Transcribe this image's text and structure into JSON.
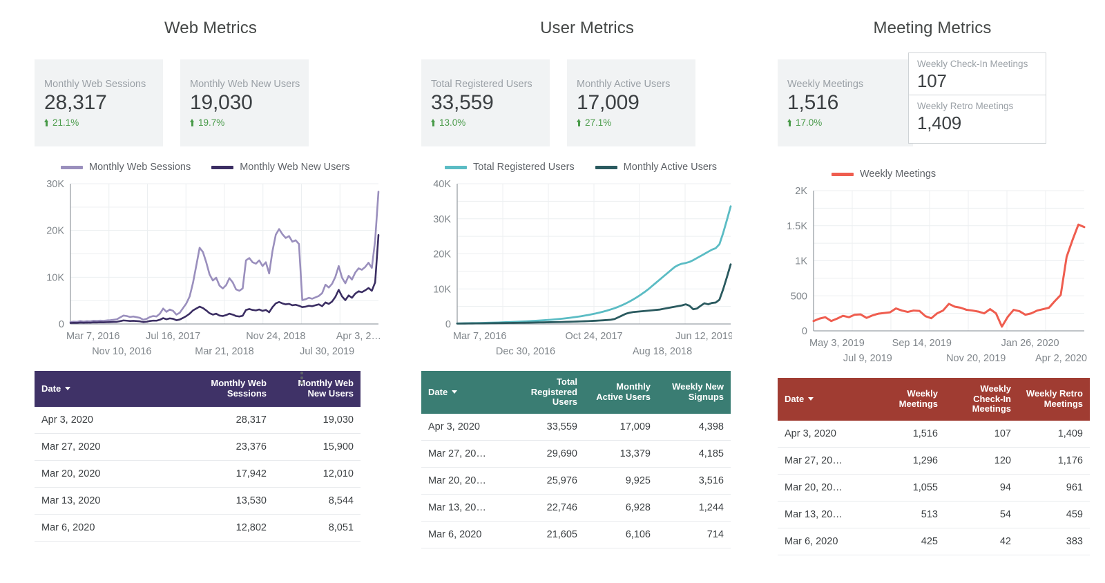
{
  "panels": [
    {
      "title": "Web Metrics",
      "scorecards": [
        {
          "label": "Monthly Web Sessions",
          "value": "28,317",
          "delta": "21.1%"
        },
        {
          "label": "Monthly Web New Users",
          "value": "19,030",
          "delta": "19.7%"
        }
      ],
      "legend": [
        {
          "label": "Monthly Web Sessions",
          "color": "#9a8fbd"
        },
        {
          "label": "Monthly Web New Users",
          "color": "#3b2e63"
        }
      ],
      "table": {
        "header_color": "#3f3267",
        "columns": [
          "Date",
          "Monthly Web Sessions",
          "Monthly Web New Users"
        ],
        "rows": [
          [
            "Apr 3, 2020",
            "28,317",
            "19,030"
          ],
          [
            "Mar 27, 2020",
            "23,376",
            "15,900"
          ],
          [
            "Mar 20, 2020",
            "17,942",
            "12,010"
          ],
          [
            "Mar 13, 2020",
            "13,530",
            "8,544"
          ],
          [
            "Mar 6, 2020",
            "12,802",
            "8,051"
          ]
        ]
      }
    },
    {
      "title": "User Metrics",
      "scorecards": [
        {
          "label": "Total Registered Users",
          "value": "33,559",
          "delta": "13.0%"
        },
        {
          "label": "Monthly Active Users",
          "value": "17,009",
          "delta": "27.1%"
        }
      ],
      "legend": [
        {
          "label": "Total Registered Users",
          "color": "#5bbcc4"
        },
        {
          "label": "Monthly Active Users",
          "color": "#2a5a5f"
        }
      ],
      "table": {
        "header_color": "#3a7d73",
        "columns": [
          "Date",
          "Total Registered Users",
          "Monthly Active Users",
          "Weekly New Signups"
        ],
        "rows": [
          [
            "Apr 3, 2020",
            "33,559",
            "17,009",
            "4,398"
          ],
          [
            "Mar 27, 20…",
            "29,690",
            "13,379",
            "4,185"
          ],
          [
            "Mar 20, 20…",
            "25,976",
            "9,925",
            "3,516"
          ],
          [
            "Mar 13, 20…",
            "22,746",
            "6,928",
            "1,244"
          ],
          [
            "Mar 6, 2020",
            "21,605",
            "6,106",
            "714"
          ]
        ]
      }
    },
    {
      "title": "Meeting Metrics",
      "scorecards": [
        {
          "label": "Weekly Meetings",
          "value": "1,516",
          "delta": "17.0%"
        }
      ],
      "boxed_scorecards": [
        {
          "label": "Weekly Check-In Meetings",
          "value": "107"
        },
        {
          "label": "Weekly Retro Meetings",
          "value": "1,409"
        }
      ],
      "legend": [
        {
          "label": "Weekly Meetings",
          "color": "#ef5d4f"
        }
      ],
      "table": {
        "header_color": "#a03c32",
        "columns": [
          "Date",
          "Weekly Meetings",
          "Weekly Check-In Meetings",
          "Weekly Retro Meetings"
        ],
        "rows": [
          [
            "Apr 3, 2020",
            "1,516",
            "107",
            "1,409"
          ],
          [
            "Mar 27, 20…",
            "1,296",
            "120",
            "1,176"
          ],
          [
            "Mar 20, 20…",
            "1,055",
            "94",
            "961"
          ],
          [
            "Mar 13, 20…",
            "513",
            "54",
            "459"
          ],
          [
            "Mar 6, 2020",
            "425",
            "42",
            "383"
          ]
        ]
      }
    }
  ],
  "chart_data": [
    {
      "type": "line",
      "title": "Web Metrics",
      "xlabel": "",
      "ylabel": "",
      "ylim": [
        0,
        30000
      ],
      "yticks": [
        0,
        10000,
        20000,
        30000
      ],
      "ytick_labels": [
        "0",
        "10K",
        "20K",
        "30K"
      ],
      "grid": true,
      "legend_position": "top",
      "xtick_labels_row1": [
        "Mar 7, 2016",
        "Jul 16, 2017",
        "Nov 24, 2018",
        "Apr 3, 2…"
      ],
      "xtick_labels_row2": [
        "Nov 10, 2016",
        "Mar 21, 2018",
        "Jul 30, 2019"
      ],
      "series": [
        {
          "name": "Monthly Web Sessions",
          "color": "#9a8fbd",
          "values": [
            420,
            500,
            460,
            620,
            520,
            600,
            560,
            700,
            650,
            720,
            680,
            760,
            800,
            900,
            1000,
            1400,
            1800,
            1700,
            1500,
            1600,
            1450,
            1300,
            900,
            1100,
            1500,
            1700,
            1600,
            2200,
            3300,
            2600,
            3100,
            2800,
            2000,
            2400,
            3400,
            4400,
            5900,
            8800,
            12500,
            16300,
            15400,
            13200,
            10600,
            9300,
            9900,
            8200,
            7600,
            8300,
            9800,
            8900,
            7400,
            7100,
            7600,
            13600,
            14100,
            13200,
            12900,
            13600,
            12400,
            13200,
            10800,
            15600,
            19100,
            20300,
            19200,
            18400,
            18800,
            17600,
            17900,
            17100,
            5100,
            5300,
            5600,
            5400,
            5700,
            6000,
            6600,
            8400,
            7800,
            8600,
            10100,
            12400,
            9900,
            8700,
            10300,
            9500,
            11000,
            11900,
            11600,
            12200,
            13100,
            12000,
            17900,
            28317
          ]
        },
        {
          "name": "Monthly Web New Users",
          "color": "#3b2e63",
          "values": [
            210,
            250,
            230,
            300,
            270,
            300,
            280,
            340,
            320,
            360,
            340,
            380,
            400,
            430,
            460,
            600,
            760,
            700,
            640,
            680,
            620,
            560,
            400,
            480,
            640,
            720,
            700,
            900,
            1250,
            1000,
            1200,
            1100,
            800,
            950,
            1300,
            1700,
            2200,
            2900,
            3300,
            3700,
            3400,
            2900,
            2300,
            2000,
            2200,
            1800,
            1700,
            1900,
            2200,
            2000,
            1700,
            1600,
            1750,
            3000,
            3200,
            3000,
            2900,
            3100,
            2800,
            3000,
            2500,
            3600,
            4400,
            4700,
            4400,
            4200,
            4300,
            4000,
            4100,
            3900,
            3600,
            3700,
            3900,
            3800,
            4000,
            4200,
            3800,
            4600,
            4300,
            4800,
            5800,
            7300,
            5900,
            5100,
            6100,
            5600,
            6500,
            7000,
            6800,
            7200,
            7700,
            7100,
            8900,
            19030
          ]
        }
      ]
    },
    {
      "type": "line",
      "title": "User Metrics",
      "xlabel": "",
      "ylabel": "",
      "ylim": [
        0,
        40000
      ],
      "yticks": [
        0,
        10000,
        20000,
        30000,
        40000
      ],
      "ytick_labels": [
        "0",
        "10K",
        "20K",
        "30K",
        "40K"
      ],
      "grid": true,
      "legend_position": "top",
      "xtick_labels_row1": [
        "Mar 7, 2016",
        "Oct 24, 2017",
        "Jun 12, 2019"
      ],
      "xtick_labels_row2": [
        "Dec 30, 2016",
        "Aug 18, 2018"
      ],
      "series": [
        {
          "name": "Total Registered Users",
          "color": "#5bbcc4",
          "values": [
            150,
            170,
            190,
            210,
            230,
            250,
            270,
            300,
            330,
            360,
            390,
            420,
            460,
            500,
            540,
            580,
            630,
            680,
            730,
            790,
            850,
            910,
            980,
            1050,
            1130,
            1210,
            1300,
            1400,
            1500,
            1620,
            1750,
            1890,
            2040,
            2200,
            2380,
            2570,
            2780,
            3000,
            3250,
            3520,
            3820,
            4150,
            4500,
            4900,
            5350,
            5850,
            6400,
            7000,
            7650,
            8350,
            9100,
            9900,
            10800,
            11700,
            12600,
            13500,
            14400,
            15300,
            16200,
            16800,
            17200,
            17400,
            17700,
            18200,
            18800,
            19400,
            20000,
            20600,
            21200,
            21605,
            22746,
            25976,
            29690,
            33559
          ]
        },
        {
          "name": "Monthly Active Users",
          "color": "#2a5a5f",
          "values": [
            120,
            130,
            140,
            150,
            160,
            170,
            180,
            190,
            200,
            215,
            230,
            245,
            260,
            275,
            290,
            305,
            320,
            340,
            360,
            380,
            400,
            420,
            440,
            460,
            480,
            500,
            520,
            545,
            570,
            600,
            630,
            660,
            700,
            740,
            780,
            820,
            870,
            920,
            980,
            1050,
            1120,
            1200,
            1400,
            1900,
            2400,
            2900,
            3200,
            3400,
            3500,
            3600,
            3700,
            3800,
            3900,
            4000,
            4100,
            4300,
            4500,
            4700,
            4900,
            5100,
            5300,
            5600,
            5200,
            4200,
            4400,
            5200,
            5900,
            5600,
            6000,
            6106,
            6928,
            9925,
            13379,
            17009
          ]
        }
      ]
    },
    {
      "type": "line",
      "title": "Meeting Metrics",
      "xlabel": "",
      "ylabel": "",
      "ylim": [
        0,
        2000
      ],
      "yticks": [
        0,
        500,
        1000,
        1500,
        2000
      ],
      "ytick_labels": [
        "0",
        "500",
        "1K",
        "1.5K",
        "2K"
      ],
      "grid": true,
      "legend_position": "top",
      "xtick_labels_row1": [
        "May 3, 2019",
        "Sep 14, 2019",
        "Jan 26, 2020"
      ],
      "xtick_labels_row2": [
        "Jul 9, 2019",
        "Nov 20, 2019",
        "Apr 2, 2020"
      ],
      "series": [
        {
          "name": "Weekly Meetings",
          "color": "#ef5d4f",
          "values": [
            140,
            175,
            195,
            140,
            175,
            215,
            195,
            230,
            235,
            185,
            220,
            245,
            255,
            265,
            320,
            290,
            270,
            290,
            285,
            210,
            180,
            250,
            290,
            385,
            345,
            330,
            300,
            290,
            275,
            250,
            310,
            250,
            60,
            200,
            300,
            280,
            230,
            250,
            290,
            310,
            330,
            425,
            513,
            1055,
            1296,
            1516,
            1480
          ]
        }
      ]
    }
  ]
}
